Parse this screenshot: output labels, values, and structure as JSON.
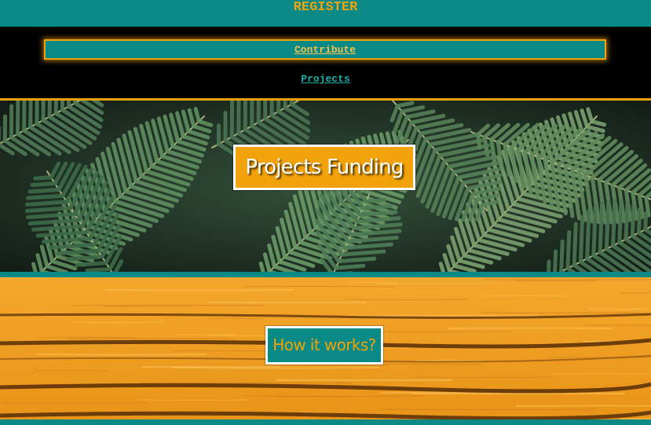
{
  "header": {
    "register_label": "REGISTER"
  },
  "nav": {
    "contribute_label": "Contribute",
    "projects_label": "Projects"
  },
  "hero": {
    "title": "Projects Funding",
    "background": "palm-leaves-image"
  },
  "how_section": {
    "button_label": "How it works?",
    "background": "wood-planks-image"
  },
  "colors": {
    "teal": "#0a8a86",
    "orange": "#f2a20a",
    "black": "#000000",
    "white": "#ffffff"
  }
}
